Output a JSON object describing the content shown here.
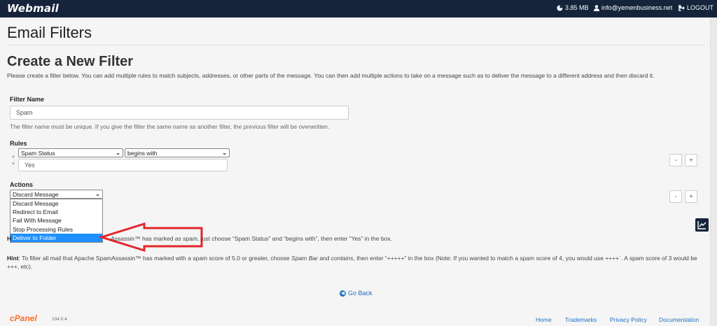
{
  "topbar": {
    "logo": "Webmail",
    "disk_usage": "3.85 MB",
    "user_email": "info@yemenbusiness.net",
    "logout_label": "LOGOUT"
  },
  "page": {
    "title": "Email Filters",
    "subtitle": "Create a New Filter",
    "intro": "Please create a filter below. You can add multiple rules to match subjects, addresses, or other parts of the message. You can then add multiple actions to take on a message such as to deliver the message to a different address and then discard it."
  },
  "filter_name": {
    "label": "Filter Name",
    "value": "Spam",
    "help": "The filter name must be unique. If you give the filter the same name as another filter, the previous filter will be overwritten."
  },
  "rules": {
    "label": "Rules",
    "field_selected": "Spam Status",
    "operator_selected": "begins with",
    "value": "Yes",
    "remove_label": "-",
    "add_label": "+"
  },
  "actions": {
    "label": "Actions",
    "selected": "Discard Message",
    "options": [
      "Discard Message",
      "Redirect to Email",
      "Fail With Message",
      "Stop Processing Rules",
      "Deliver to Folder"
    ],
    "highlighted_index": 4,
    "remove_label": "-",
    "add_label": "+"
  },
  "hints": {
    "hint1_prefix": "H",
    "hint1_text": "Assassin™ has marked as spam, just choose “Spam Status” and “begins with”, then enter “Yes” in the box.",
    "hint2_label": "Hint",
    "hint2_part1": ": To filter all mail that Apache SpamAssassin™ has marked with a spam score of 5.0 or greater, choose ",
    "hint2_em1": "Spam Bar",
    "hint2_part2": " and ",
    "hint2_em2": "contains",
    "hint2_part3": ", then enter “+++++” in the box (Note: If you wanted to match a spam score of 4, you would use ++++`. A spam score of 3 would be +++, etc)."
  },
  "go_back": "Go Back",
  "footer": {
    "brand": "cPanel",
    "version": "104.0.4",
    "links": [
      "Home",
      "Trademarks",
      "Privacy Policy",
      "Documentation"
    ]
  },
  "colors": {
    "topbar_bg": "#15243b",
    "link": "#1f6fc0",
    "highlight": "#1e90ff",
    "annotation_arrow": "#e3262b",
    "brand": "#ff6c2c"
  },
  "icons": {
    "quota": "pie-chart-icon",
    "user": "user-icon",
    "logout": "logout-icon",
    "go_back": "circle-arrow-left-icon",
    "chart": "line-chart-icon"
  }
}
